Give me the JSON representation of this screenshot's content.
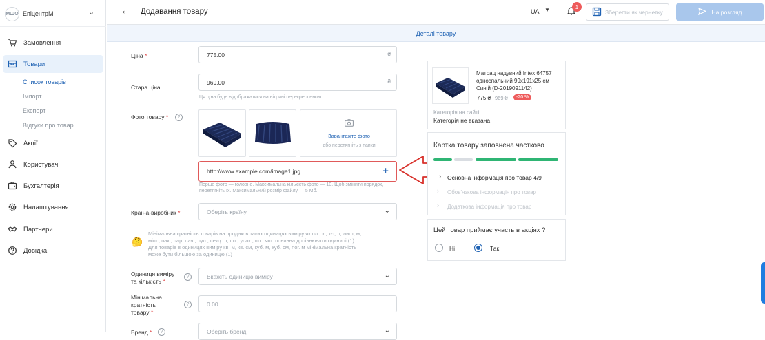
{
  "sidebar": {
    "logo_text": "МШО",
    "shop_name": "ЕпіцентрМ",
    "items": [
      {
        "label": "Замовлення",
        "icon": "cart-icon"
      },
      {
        "label": "Товари",
        "icon": "box-icon"
      },
      {
        "label": "Акції",
        "icon": "discount-icon"
      },
      {
        "label": "Користувачі",
        "icon": "users-icon"
      },
      {
        "label": "Бухгалтерія",
        "icon": "wallet-icon"
      },
      {
        "label": "Налаштування",
        "icon": "gear-icon"
      },
      {
        "label": "Партнери",
        "icon": "handshake-icon"
      },
      {
        "label": "Довідка",
        "icon": "question-icon"
      }
    ],
    "sub_items": [
      "Список товарів",
      "Імпорт",
      "Експорт",
      "Відгуки про товар"
    ]
  },
  "topbar": {
    "title": "Додавання товару",
    "language": "UA",
    "notification_count": "1",
    "draft_label": "Зберегти як чернетку",
    "review_label": "На розгляд"
  },
  "banner": "Деталі товару",
  "form": {
    "price_label": "Ціна",
    "price_value": "775.00",
    "currency": "₴",
    "old_price_label": "Стара ціна",
    "old_price_value": "969.00",
    "old_price_hint": "Ця ціна буде відображатися на вітрині перекресленою",
    "photo_label": "Фото товару",
    "upload_label": "Завантажте фото",
    "upload_sub": "або перетягніть з папки",
    "url_value": "http://www.example.com/image1.jpg",
    "photo_hint_1": "Перше фото — головне. Максимальна кількість фото — 10. Щоб змінити порядок,",
    "photo_hint_2": "перетягніть їх. Максимальний розмір файлу — 5 Мб.",
    "country_label": "Країна-виробник",
    "country_placeholder": "Оберіть країну",
    "min_info_1": "Мінімальна кратність товарів на продаж в таких одиницях виміру як пл., кг, к-т, л, лист, м,",
    "min_info_2": "міш., пак., пар, пач., рул., секц., т, шт., упак., шт., ящ. повинна дорівнювати одиниці (1).",
    "min_info_3": "Для товарів в одиницях виміру кв. м, кв. см, куб. м, куб. см, пог. м мінімальна кратність",
    "min_info_4": "може бути більшою за одиницю (1)",
    "unit_label_1": "Одиниця виміру",
    "unit_label_2": "та кількість",
    "unit_placeholder": "Вкажіть одиницю виміру",
    "min_mult_label_1": "Мінімальна",
    "min_mult_label_2": "кратність",
    "min_mult_label_3": "товару",
    "min_mult_value": "0.00",
    "brand_label": "Бренд",
    "brand_placeholder": "Оберіть бренд"
  },
  "preview": {
    "name_1": "Матрац надувний Intex 64757",
    "name_2": "односпальний 99x191x25 см",
    "name_3": "Синій (D-2019091142)",
    "price": "775 ₴",
    "old_price": "969 ₴",
    "discount": "-20 %",
    "category_label": "Категорія на сайті",
    "category_value": "Категорія не вказана"
  },
  "completeness": {
    "title": "Картка товару заповнена частково",
    "segments": [
      "#2fb574",
      "#d9dde2",
      "#2fb574",
      "#2fb574"
    ],
    "items": [
      {
        "label": "Основна інформація про товар 4/9",
        "active": true
      },
      {
        "label": "Обов'язкова інформація про товар",
        "active": false
      },
      {
        "label": "Додаткова інформація про товар",
        "active": false
      }
    ]
  },
  "promo": {
    "question": "Цей товар приймає участь в акціях ?",
    "option_no": "Ні",
    "option_yes": "Так",
    "selected": "Так"
  },
  "colors": {
    "accent": "#1f62b3",
    "success": "#2fb574",
    "danger": "#ee5b5b",
    "arrow": "#d8312b"
  }
}
